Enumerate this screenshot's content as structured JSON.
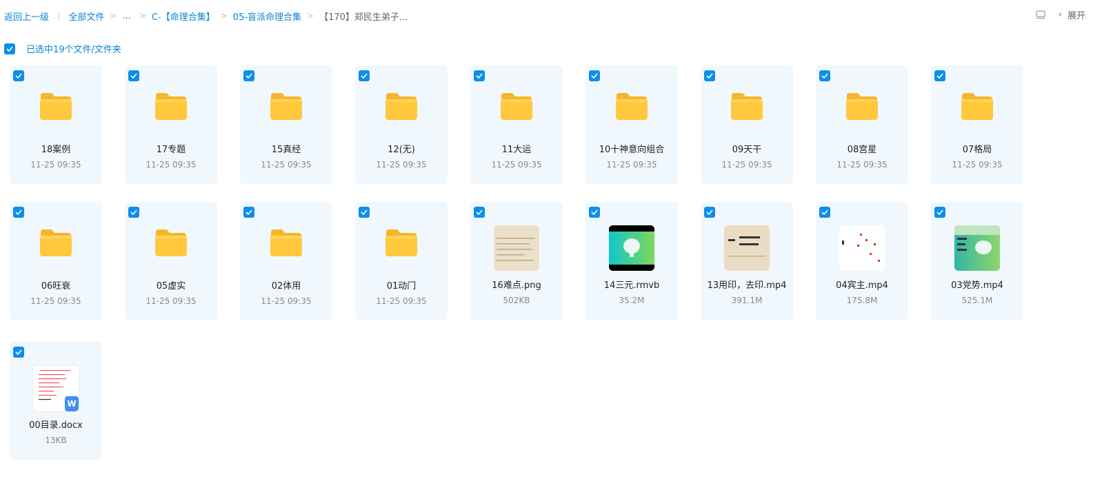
{
  "breadcrumb": {
    "back": "返回上一级",
    "root": "全部文件",
    "ellipsis": "...",
    "level1": "C-【命理合集】",
    "level2": "05-盲派命理合集",
    "current": "【170】郑民生弟子..."
  },
  "toolbar": {
    "expand_label": "展开"
  },
  "selection": {
    "label": "已选中19个文件/文件夹"
  },
  "colors": {
    "accent": "#0a84d6",
    "checkbox": "#0c8fea",
    "card_bg": "#f1f8fd",
    "folder": "#ffc83d"
  },
  "items": [
    {
      "type": "folder",
      "name": "18案例",
      "meta": "11-25 09:35"
    },
    {
      "type": "folder",
      "name": "17专题",
      "meta": "11-25 09:35"
    },
    {
      "type": "folder",
      "name": "15真经",
      "meta": "11-25 09:35"
    },
    {
      "type": "folder",
      "name": "12(无)",
      "meta": "11-25 09:35"
    },
    {
      "type": "folder",
      "name": "11大运",
      "meta": "11-25 09:35"
    },
    {
      "type": "folder",
      "name": "10十神意向组合",
      "meta": "11-25 09:35"
    },
    {
      "type": "folder",
      "name": "09天干",
      "meta": "11-25 09:35"
    },
    {
      "type": "folder",
      "name": "08宫星",
      "meta": "11-25 09:35"
    },
    {
      "type": "folder",
      "name": "07格局",
      "meta": "11-25 09:35"
    },
    {
      "type": "folder",
      "name": "06旺衰",
      "meta": "11-25 09:35"
    },
    {
      "type": "folder",
      "name": "05虚实",
      "meta": "11-25 09:35"
    },
    {
      "type": "folder",
      "name": "02体用",
      "meta": "11-25 09:35"
    },
    {
      "type": "folder",
      "name": "01动门",
      "meta": "11-25 09:35"
    },
    {
      "type": "image",
      "name": "16难点.png",
      "meta": "502KB"
    },
    {
      "type": "video-teal",
      "name": "14三元.rmvb",
      "meta": "35.2M"
    },
    {
      "type": "video-paper",
      "name": "13用印，去印.mp4",
      "meta": "391.1M"
    },
    {
      "type": "video-white",
      "name": "04宾主.mp4",
      "meta": "175.8M"
    },
    {
      "type": "video-green",
      "name": "03党势.mp4",
      "meta": "525.1M"
    },
    {
      "type": "doc",
      "name": "00目录.docx",
      "meta": "13KB"
    }
  ]
}
